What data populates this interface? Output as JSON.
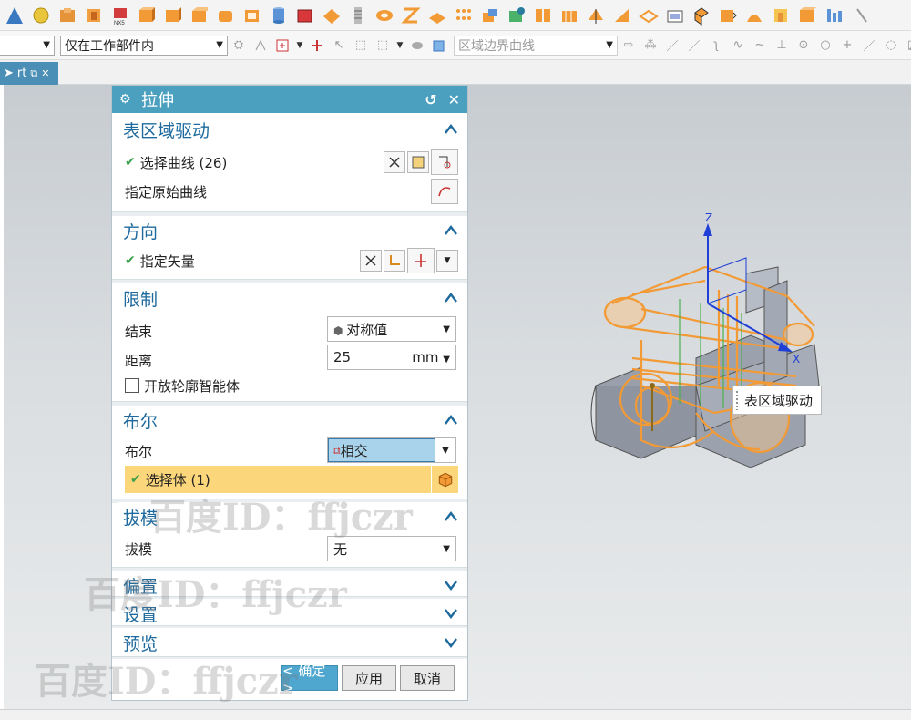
{
  "toolbar2": {
    "filter_value": "",
    "scope_value": "仅在工作部件内",
    "curve_rule_value": "区域边界曲线"
  },
  "tab": {
    "label": "rt"
  },
  "dialog": {
    "title": "拉伸",
    "sections": {
      "region": {
        "title": "表区域驱动",
        "select_curve": "选择曲线 (26)",
        "original_curve": "指定原始曲线"
      },
      "direction": {
        "title": "方向",
        "vector": "指定矢量"
      },
      "limits": {
        "title": "限制",
        "end_label": "结束",
        "end_value": "对称值",
        "distance_label": "距离",
        "distance_value": "25",
        "distance_unit": "mm",
        "open_profile": "开放轮廓智能体"
      },
      "boolean": {
        "title": "布尔",
        "boolean_label": "布尔",
        "boolean_value": "相交",
        "select_body": "选择体 (1)"
      },
      "draft": {
        "title": "拔模",
        "draft_label": "拔模",
        "draft_value": "无"
      },
      "offset": {
        "title": "偏置"
      },
      "settings": {
        "title": "设置"
      },
      "preview": {
        "title": "预览"
      }
    },
    "buttons": {
      "ok": "< 确定 >",
      "apply": "应用",
      "cancel": "取消"
    }
  },
  "viewport": {
    "tooltip": "表区域驱动",
    "axis_z": "Z",
    "axis_x": "X"
  },
  "watermarks": [
    "百度ID：ffjczr",
    "百度ID：ffjczr",
    "百度ID：ffjczr"
  ],
  "colors": {
    "accent": "#4ba0c0",
    "section_title": "#1e6a9e",
    "highlight": "#fcd67a",
    "model_orange": "#f29a35"
  }
}
